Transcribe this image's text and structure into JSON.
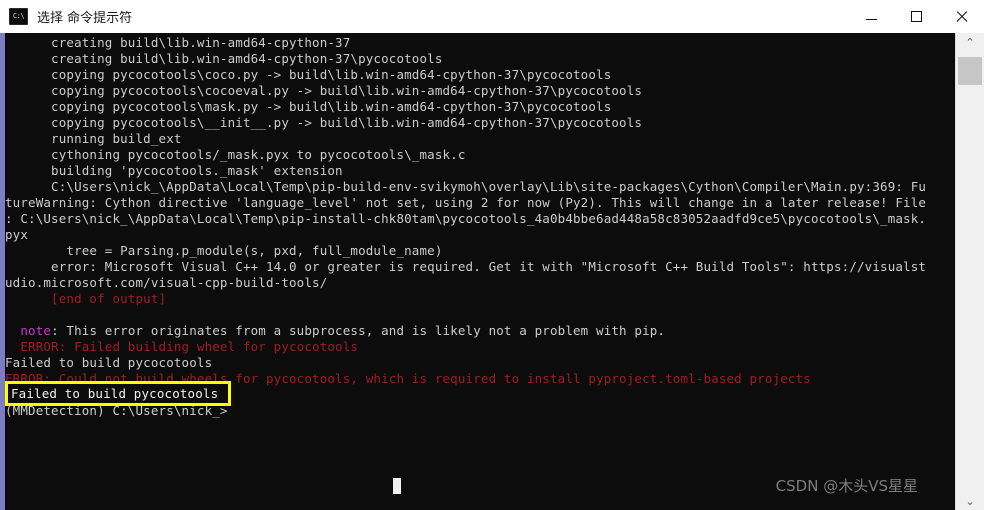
{
  "window": {
    "title": "选择 命令提示符",
    "icon": "console-icon",
    "controls": {
      "minimize": "—",
      "maximize": "▢",
      "close": "✕"
    }
  },
  "console": {
    "background_color": "#0c0c0c",
    "foreground_color": "#cccccc",
    "error_color": "#9d1f23",
    "note_color": "#c838c8",
    "left_border_color": "#7b7ec4",
    "lines": [
      {
        "text": "      creating build\\lib.win-amd64-cpython-37",
        "color": "white"
      },
      {
        "text": "      creating build\\lib.win-amd64-cpython-37\\pycocotools",
        "color": "white"
      },
      {
        "text": "      copying pycocotools\\coco.py -> build\\lib.win-amd64-cpython-37\\pycocotools",
        "color": "white"
      },
      {
        "text": "      copying pycocotools\\cocoeval.py -> build\\lib.win-amd64-cpython-37\\pycocotools",
        "color": "white"
      },
      {
        "text": "      copying pycocotools\\mask.py -> build\\lib.win-amd64-cpython-37\\pycocotools",
        "color": "white"
      },
      {
        "text": "      copying pycocotools\\__init__.py -> build\\lib.win-amd64-cpython-37\\pycocotools",
        "color": "white"
      },
      {
        "text": "      running build_ext",
        "color": "white"
      },
      {
        "text": "      cythoning pycocotools/_mask.pyx to pycocotools\\_mask.c",
        "color": "white"
      },
      {
        "text": "      building 'pycocotools._mask' extension",
        "color": "white"
      },
      {
        "text": "      C:\\Users\\nick_\\AppData\\Local\\Temp\\pip-build-env-svikymoh\\overlay\\Lib\\site-packages\\Cython\\Compiler\\Main.py:369: Fu",
        "color": "white"
      },
      {
        "text": "tureWarning: Cython directive 'language_level' not set, using 2 for now (Py2). This will change in a later release! File",
        "color": "white"
      },
      {
        "text": ": C:\\Users\\nick_\\AppData\\Local\\Temp\\pip-install-chk80tam\\pycocotools_4a0b4bbe6ad448a58c83052aadfd9ce5\\pycocotools\\_mask.",
        "color": "white"
      },
      {
        "text": "pyx",
        "color": "white"
      },
      {
        "text": "        tree = Parsing.p_module(s, pxd, full_module_name)",
        "color": "white"
      },
      {
        "text": "      error: Microsoft Visual C++ 14.0 or greater is required. Get it with \"Microsoft C++ Build Tools\": https://visualst",
        "color": "white"
      },
      {
        "text": "udio.microsoft.com/visual-cpp-build-tools/",
        "color": "white"
      },
      {
        "text": "      [end of output]",
        "color": "red"
      },
      {
        "text": "",
        "color": "white"
      },
      {
        "text": "  note: This error originates from a subprocess, and is likely not a problem with pip.",
        "color": "white",
        "prefix": "  note",
        "prefix_color": "magenta"
      },
      {
        "text": "  ERROR: Failed building wheel for pycocotools",
        "color": "red"
      },
      {
        "text": "Failed to build pycocotools",
        "color": "white"
      },
      {
        "text": "ERROR: Could not build wheels for pycocotools, which is required to install pyproject.toml-based projects",
        "color": "red"
      },
      {
        "text": "",
        "color": "white"
      },
      {
        "text": "(MMDetection) C:\\Users\\nick_>",
        "color": "white"
      }
    ]
  },
  "annotation": {
    "label": "Failed to build pycocotools",
    "border_color": "#ffff00"
  },
  "watermark": {
    "text": "CSDN @木头VS星星"
  },
  "scrollbar": {
    "up_arrow": "⌃",
    "down_arrow": "⌄"
  }
}
